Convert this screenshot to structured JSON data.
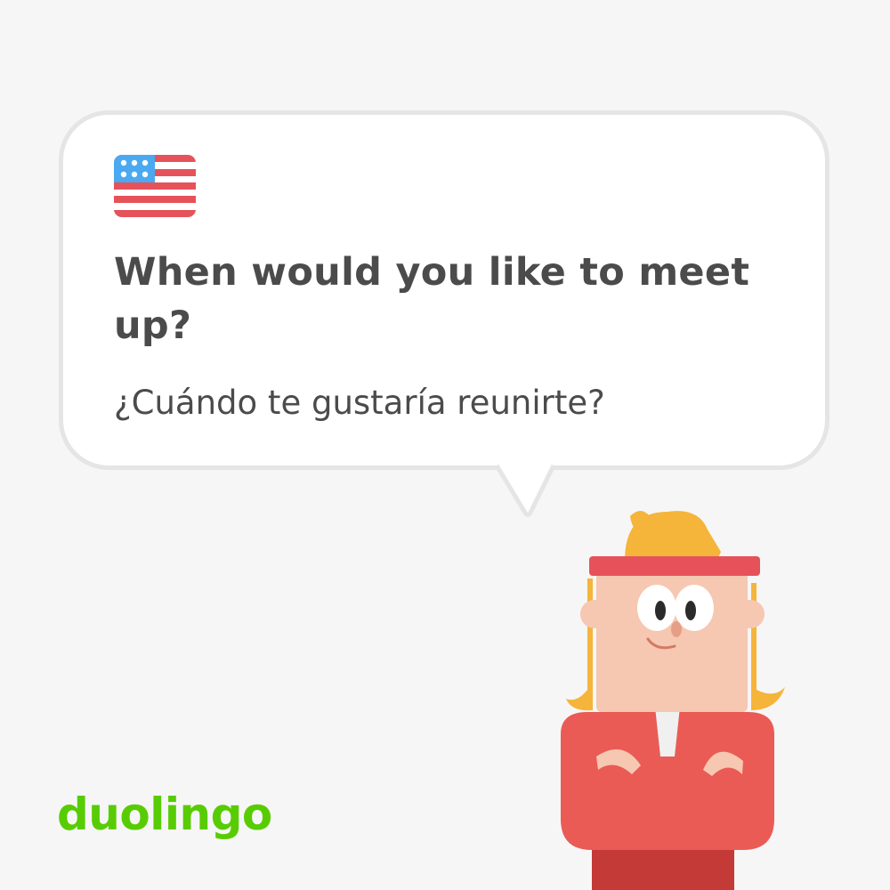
{
  "card": {
    "flag_icon": "us-flag-icon",
    "title": "When would you like to meet up?",
    "translation": "¿Cuándo te gustaría reunirte?"
  },
  "brand": {
    "logo_text": "duolingo",
    "logo_color": "#58cc02"
  },
  "colors": {
    "background": "#f6f6f6",
    "bubble_border": "#e5e5e5",
    "text": "#4b4b4b",
    "flag_red": "#e6525a",
    "flag_blue": "#4aa9f0",
    "hair": "#f5b43a",
    "skin": "#f6c7b1",
    "shirt": "#ea5b55"
  }
}
